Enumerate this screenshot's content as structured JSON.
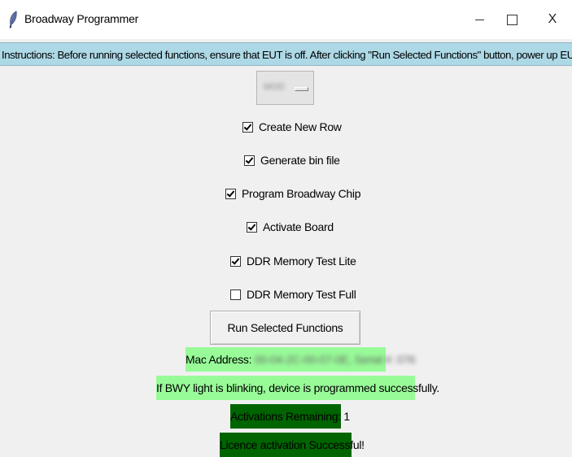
{
  "window": {
    "title": "Broadway Programmer",
    "icons": {
      "app": "feather-icon",
      "minimize": "minimize-icon",
      "maximize": "maximize-icon",
      "close": "close-icon"
    },
    "close_glyph": "X"
  },
  "instructions": "Instructions: Before running selected functions, ensure that EUT is off. After clicking \"Run Selected Functions\" button, power up EUT.",
  "option_menu": {
    "value": "MOD"
  },
  "checkboxes": [
    {
      "label": "Create New Row",
      "checked": true
    },
    {
      "label": "Generate bin file",
      "checked": true
    },
    {
      "label": "Program Broadway Chip",
      "checked": true
    },
    {
      "label": "Activate Board",
      "checked": true
    },
    {
      "label": "DDR Memory Test Lite",
      "checked": true
    },
    {
      "label": "DDR Memory Test Full",
      "checked": false
    }
  ],
  "run_button": "Run Selected Functions",
  "mac_address": {
    "label": "Mac Address:",
    "value": "00-04-2C-00-07-0E, Serial #: 076"
  },
  "bwy_message": "If BWY light is blinking, device is programmed successfully.",
  "activations": "Activations Remaining: 1",
  "licence": "Licence activation Successful!",
  "colors": {
    "instructions_bg": "#add8e6",
    "light_green": "#98fb98",
    "dark_green": "#006400",
    "window_bg": "#f0f0f0"
  }
}
